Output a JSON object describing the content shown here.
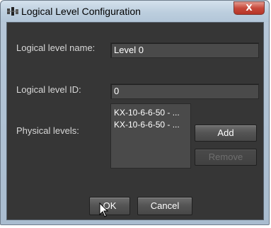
{
  "window": {
    "title": "Logical Level Configuration",
    "close_glyph": "X"
  },
  "form": {
    "name_label": "Logical level name:",
    "name_value": "Level 0",
    "id_label": "Logical level ID:",
    "id_value": "0",
    "physical_label": "Physical levels:",
    "physical_items": [
      "KX-10-6-6-50 - ...",
      "KX-10-6-6-50 - ..."
    ]
  },
  "buttons": {
    "add": "Add",
    "remove": "Remove",
    "ok": "OK",
    "cancel": "Cancel"
  },
  "colors": {
    "client_bg": "#363636",
    "field_bg": "#4a4a4a",
    "close_red": "#c7493b"
  },
  "icons": {
    "app": "app-logo-icon",
    "cursor": "mouse-pointer-icon"
  }
}
